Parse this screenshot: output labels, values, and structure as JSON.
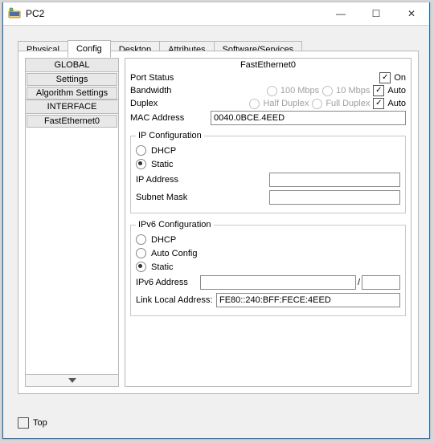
{
  "window": {
    "title": "PC2"
  },
  "win_buttons": {
    "min": "—",
    "max": "☐",
    "close": "✕"
  },
  "tabs": [
    "Physical",
    "Config",
    "Desktop",
    "Attributes",
    "Software/Services"
  ],
  "active_tab": 1,
  "side": {
    "global_hdr": "GLOBAL",
    "settings": "Settings",
    "algo": "Algorithm Settings",
    "iface_hdr": "INTERFACE",
    "fe0": "FastEthernet0"
  },
  "main": {
    "header": "FastEthernet0",
    "port_status_lbl": "Port Status",
    "on_lbl": "On",
    "bandwidth_lbl": "Bandwidth",
    "bw_100": "100 Mbps",
    "bw_10": "10 Mbps",
    "auto_lbl": "Auto",
    "duplex_lbl": "Duplex",
    "half": "Half Duplex",
    "full": "Full Duplex",
    "mac_lbl": "MAC Address",
    "mac_val": "0040.0BCE.4EED"
  },
  "ipcfg": {
    "legend": "IP Configuration",
    "dhcp": "DHCP",
    "static": "Static",
    "ip_lbl": "IP Address",
    "ip_val": "",
    "mask_lbl": "Subnet Mask",
    "mask_val": ""
  },
  "ip6cfg": {
    "legend": "IPv6 Configuration",
    "dhcp": "DHCP",
    "auto": "Auto Config",
    "static": "Static",
    "addr_lbl": "IPv6 Address",
    "addr_val": "",
    "pfx_val": "",
    "ll_lbl": "Link Local Address:",
    "ll_val": "FE80::240:BFF:FECE:4EED"
  },
  "bottom": {
    "top_lbl": "Top"
  }
}
